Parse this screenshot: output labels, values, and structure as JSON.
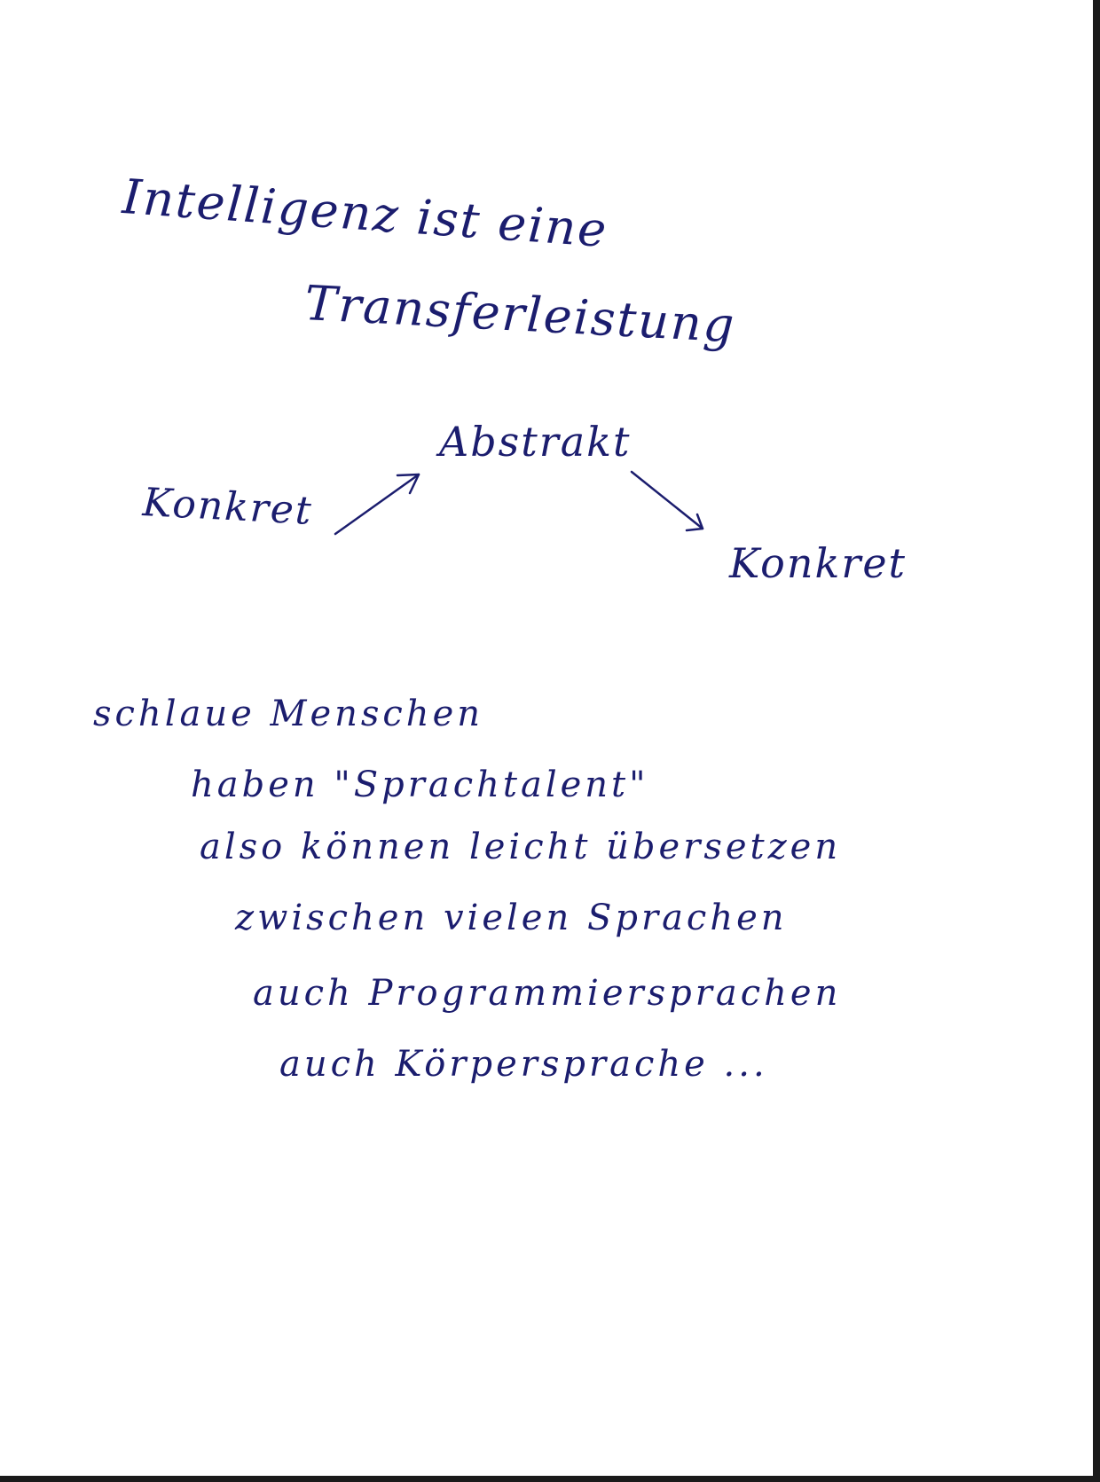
{
  "note": {
    "title_line_1": "Intelligenz ist eine",
    "title_line_2": "Transferleistung",
    "diagram": {
      "left": "Konkret",
      "top": "Abstrakt",
      "right": "Konkret"
    },
    "lines": [
      "schlaue Menschen",
      "haben \"Sprachtalent\"",
      "also können leicht übersetzen",
      "zwischen vielen Sprachen",
      "auch Programmiersprachen",
      "auch Körpersprache ..."
    ]
  },
  "colors": {
    "ink": "#1b1d6e",
    "paper": "#ffffff",
    "scan_edge": "#1a1a1a"
  }
}
